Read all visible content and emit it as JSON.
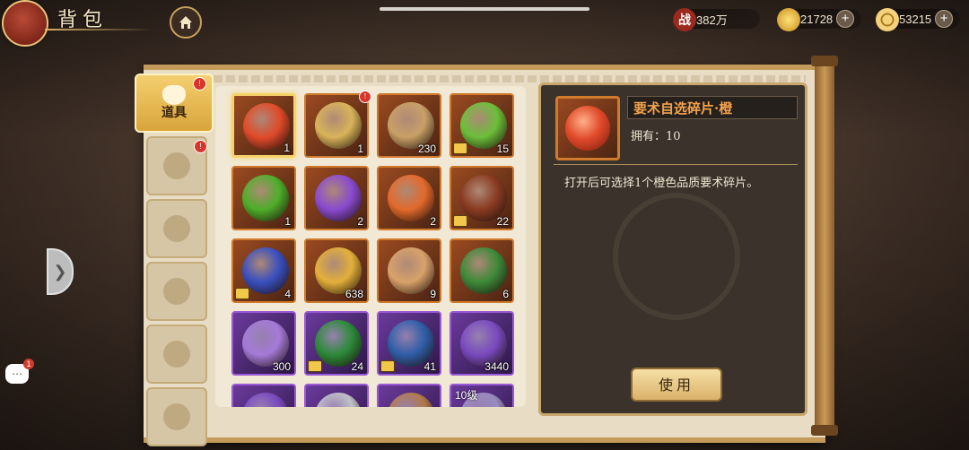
{
  "header": {
    "title": "背包",
    "resources": [
      {
        "icon": "battle-power-icon",
        "icon_text": "战",
        "value": "382万",
        "has_plus": false
      },
      {
        "icon": "gold-ingot-icon",
        "icon_text": "",
        "value": "21728",
        "has_plus": true
      },
      {
        "icon": "coin-icon",
        "icon_text": "",
        "value": "53215",
        "has_plus": true
      }
    ]
  },
  "tabs": [
    {
      "label": "道具",
      "icon": "bag-icon",
      "active": true,
      "badge": "!"
    },
    {
      "label": "",
      "icon": "helmet-icon",
      "active": false,
      "badge": "!"
    },
    {
      "label": "",
      "icon": "sword-icon",
      "active": false,
      "badge": ""
    },
    {
      "label": "",
      "icon": "triangle-icon",
      "active": false,
      "badge": ""
    },
    {
      "label": "",
      "icon": "horse-icon",
      "active": false,
      "badge": ""
    },
    {
      "label": "",
      "icon": "misc-icon",
      "active": false,
      "badge": ""
    }
  ],
  "chat": {
    "badge": "1"
  },
  "items": [
    {
      "count": "1",
      "style": "orange",
      "icon": "red-orb-icon",
      "color": "#e04a2a",
      "selected": true,
      "locked": false,
      "badge": "",
      "tag": ""
    },
    {
      "count": "1",
      "style": "orange",
      "icon": "golden-card-icon",
      "color": "#d9b45a",
      "selected": false,
      "locked": false,
      "badge": "!",
      "tag": ""
    },
    {
      "count": "230",
      "style": "orange",
      "icon": "puzzle-icon",
      "color": "#c9a067",
      "selected": false,
      "locked": false,
      "badge": "",
      "tag": ""
    },
    {
      "count": "15",
      "style": "orange",
      "icon": "green-gold-orb-icon",
      "color": "#6cbf3a",
      "selected": false,
      "locked": true,
      "badge": "",
      "tag": ""
    },
    {
      "count": "1",
      "style": "orange",
      "icon": "green-orb-icon",
      "color": "#4fae2a",
      "selected": false,
      "locked": false,
      "badge": "",
      "tag": ""
    },
    {
      "count": "2",
      "style": "orange",
      "icon": "purple-orb-icon",
      "color": "#8a4ad0",
      "selected": false,
      "locked": false,
      "badge": "",
      "tag": ""
    },
    {
      "count": "2",
      "style": "orange",
      "icon": "red-orange-orb-icon",
      "color": "#e36a2c",
      "selected": false,
      "locked": false,
      "badge": "",
      "tag": ""
    },
    {
      "count": "22",
      "style": "orange",
      "icon": "rune-seal-icon",
      "color": "#8a3b22",
      "selected": false,
      "locked": true,
      "badge": "",
      "tag": ""
    },
    {
      "count": "4",
      "style": "orange",
      "icon": "blue-rune-icon",
      "color": "#3a4fc0",
      "selected": false,
      "locked": true,
      "badge": "",
      "tag": ""
    },
    {
      "count": "638",
      "style": "orange",
      "icon": "gold-crystal-icon",
      "color": "#e3b03a",
      "selected": false,
      "locked": false,
      "badge": "",
      "tag": ""
    },
    {
      "count": "9",
      "style": "orange",
      "icon": "buns-basket-icon",
      "color": "#d8a26a",
      "selected": false,
      "locked": false,
      "badge": "",
      "tag": ""
    },
    {
      "count": "6",
      "style": "orange",
      "icon": "green-scroll-icon",
      "color": "#3e8a3a",
      "selected": false,
      "locked": false,
      "badge": "",
      "tag": ""
    },
    {
      "count": "300",
      "style": "purple",
      "icon": "purple-scroll-icon",
      "color": "#a57ad8",
      "selected": false,
      "locked": false,
      "badge": "",
      "tag": ""
    },
    {
      "count": "24",
      "style": "purple",
      "icon": "triforce-emblem-icon",
      "color": "#2d8a3a",
      "selected": false,
      "locked": true,
      "badge": "",
      "tag": ""
    },
    {
      "count": "41",
      "style": "purple",
      "icon": "triskele-emblem-icon",
      "color": "#2f5ea8",
      "selected": false,
      "locked": true,
      "badge": "",
      "tag": ""
    },
    {
      "count": "3440",
      "style": "purple",
      "icon": "purple-crystal-icon",
      "color": "#7a4ac0",
      "selected": false,
      "locked": false,
      "badge": "",
      "tag": ""
    },
    {
      "count": "",
      "style": "purple",
      "icon": "purple-item-icon",
      "color": "#7a4ac0",
      "selected": false,
      "locked": false,
      "badge": "",
      "tag": ""
    },
    {
      "count": "",
      "style": "purple",
      "icon": "silver-item-icon",
      "color": "#c0c0c8",
      "selected": false,
      "locked": false,
      "badge": "",
      "tag": ""
    },
    {
      "count": "",
      "style": "purple",
      "icon": "bronze-item-icon",
      "color": "#b07a4a",
      "selected": false,
      "locked": false,
      "badge": "",
      "tag": ""
    },
    {
      "count": "",
      "style": "purple",
      "icon": "level-item-icon",
      "color": "#9a8ac0",
      "selected": false,
      "locked": false,
      "badge": "",
      "tag": "10级"
    }
  ],
  "detail": {
    "name": "要术自选碎片·橙",
    "owned": "拥有：10",
    "description": "打开后可选择1个橙色品质要术碎片。",
    "use_button": "使用"
  }
}
